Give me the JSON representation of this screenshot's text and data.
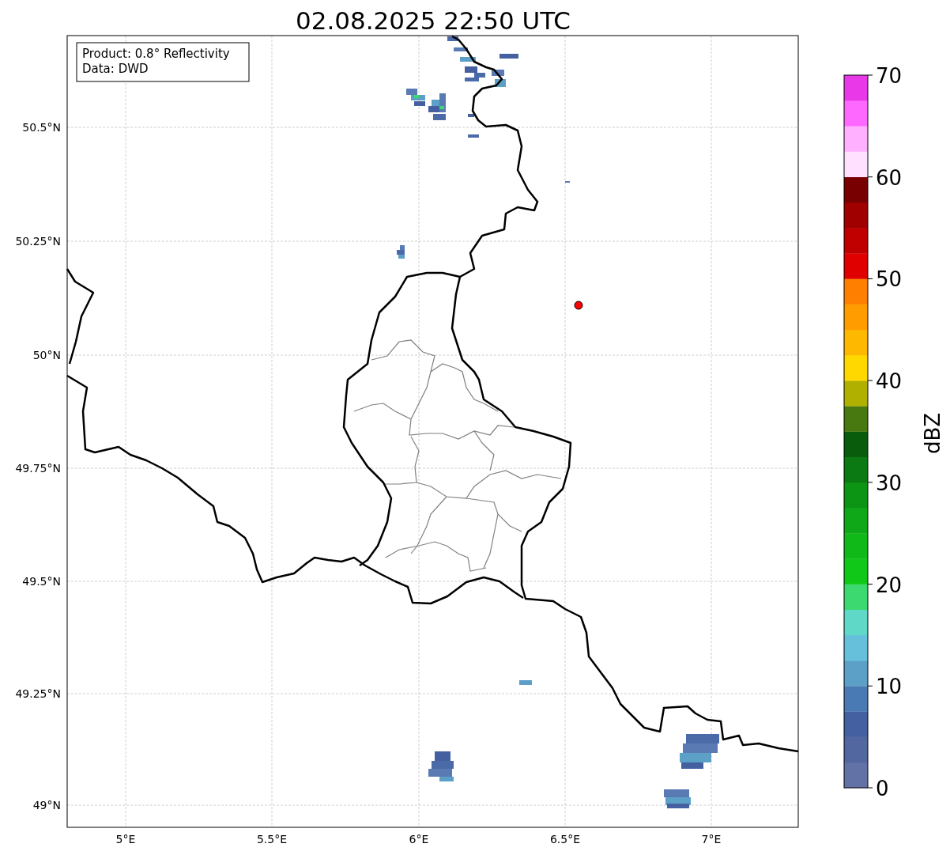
{
  "title": "02.08.2025 22:50 UTC",
  "info_box": {
    "lines": [
      "Product: 0.8° Reflectivity",
      "Data: DWD"
    ]
  },
  "map": {
    "y_ticks": [
      "50.5°N",
      "50.25°N",
      "50°N",
      "49.75°N",
      "49.5°N",
      "49.25°N",
      "49°N"
    ],
    "x_ticks": [
      "5°E",
      "5.5°E",
      "6°E",
      "6.5°E",
      "7°E"
    ]
  },
  "colorbar": {
    "label": "dBZ",
    "ticks": [
      "70",
      "60",
      "50",
      "40",
      "30",
      "20",
      "10",
      "0"
    ],
    "levels": [
      {
        "color": "#6272a6"
      },
      {
        "color": "#5266a0"
      },
      {
        "color": "#4460a0"
      },
      {
        "color": "#4a7ab4"
      },
      {
        "color": "#5ca0c8"
      },
      {
        "color": "#66c0dc"
      },
      {
        "color": "#60d8c8"
      },
      {
        "color": "#3cd870"
      },
      {
        "color": "#10c818"
      },
      {
        "color": "#10b818"
      },
      {
        "color": "#0ea818"
      },
      {
        "color": "#0c9414"
      },
      {
        "color": "#0b7a12"
      },
      {
        "color": "#085c0c"
      },
      {
        "color": "#487810"
      },
      {
        "color": "#b0b000"
      },
      {
        "color": "#ffd800"
      },
      {
        "color": "#ffb800"
      },
      {
        "color": "#ff9c00"
      },
      {
        "color": "#ff8000"
      },
      {
        "color": "#e00000"
      },
      {
        "color": "#c00000"
      },
      {
        "color": "#a00000"
      },
      {
        "color": "#780000"
      },
      {
        "color": "#ffe0ff"
      },
      {
        "color": "#ffb0ff"
      },
      {
        "color": "#ff68ff"
      },
      {
        "color": "#e838e8"
      }
    ]
  }
}
